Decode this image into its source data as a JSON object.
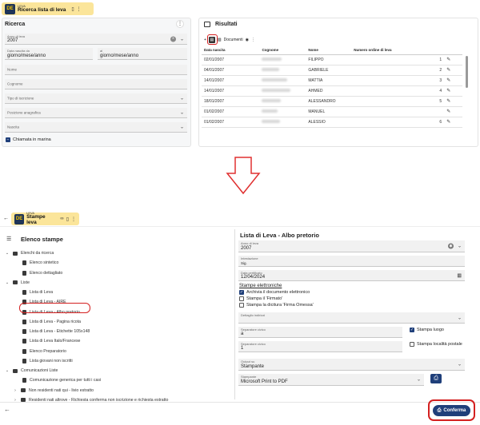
{
  "top": {
    "app_tab": {
      "logo": "DE",
      "subtitle": "LEVA",
      "title": "Ricerca lista di leva",
      "pin_icon": "pin-icon",
      "close_icon": "close-icon",
      "menu_icon": "more-vert-icon"
    },
    "search_panel": {
      "title": "Ricerca",
      "menu_icon": "more-vert-icon",
      "anno_label": "Anno di leva",
      "anno_value": "2007",
      "data_nascita_label": "Data nascita da",
      "data_nascita_value": "giorno/mese/anno",
      "al_label": "al",
      "al_value": "giorno/mese/anno",
      "nome_placeholder": "Nome",
      "cognome_placeholder": "Cognome",
      "tipo_iscrizione_placeholder": "Tipo di iscrizione",
      "posizione_placeholder": "Posizione anagrafica",
      "nascita_placeholder": "Nascita",
      "chiamata_label": "Chiamata in marina"
    },
    "results_panel": {
      "title": "Risultati",
      "docs_label": "Documenti",
      "columns": [
        "Data nascita",
        "Cognome",
        "Nome",
        "Numero ordine di leva"
      ],
      "rows": [
        {
          "date": "02/01/2007",
          "nome": "FILIPPO",
          "num": "1"
        },
        {
          "date": "04/01/2007",
          "nome": "GABRIELE",
          "num": "2"
        },
        {
          "date": "14/01/2007",
          "nome": "MATTIA",
          "num": "3"
        },
        {
          "date": "14/01/2007",
          "nome": "AHMED",
          "num": "4"
        },
        {
          "date": "18/01/2007",
          "nome": "ALESSANDRO",
          "num": "5"
        },
        {
          "date": "01/02/2007",
          "nome": "MANUEL",
          "num": ""
        },
        {
          "date": "01/02/2007",
          "nome": "ALESSIO",
          "num": "6"
        }
      ]
    }
  },
  "bottom": {
    "app_tab": {
      "logo": "DE",
      "subtitle": "LEVA",
      "title": "Stampe leva"
    },
    "left_panel": {
      "title": "Elenco stampe",
      "tree": [
        {
          "level": 0,
          "type": "folder",
          "label": "Elenchi da ricerca",
          "caret": "v"
        },
        {
          "level": 1,
          "type": "doc",
          "label": "Elenco sintetico"
        },
        {
          "level": 1,
          "type": "doc",
          "label": "Elenco dettagliato"
        },
        {
          "level": 0,
          "type": "folder",
          "label": "Liste",
          "caret": "v"
        },
        {
          "level": 1,
          "type": "doc",
          "label": "Lista di Leva"
        },
        {
          "level": 1,
          "type": "doc",
          "label": "Lista di Leva - AIRE"
        },
        {
          "level": 1,
          "type": "doc",
          "label": "Lista di Leva - Albo pretorio"
        },
        {
          "level": 1,
          "type": "doc",
          "label": "Lista di Leva - Pagina ricota"
        },
        {
          "level": 1,
          "type": "doc",
          "label": "Lista di Leva - Etichette 105x148"
        },
        {
          "level": 1,
          "type": "doc",
          "label": "Lista di Leva Italo/Francese"
        },
        {
          "level": 1,
          "type": "doc",
          "label": "Elenco Preparatorio"
        },
        {
          "level": 1,
          "type": "doc",
          "label": "Lista giovani non iscritti"
        },
        {
          "level": 0,
          "type": "folder",
          "label": "Comunicazioni Liste",
          "caret": "v"
        },
        {
          "level": 1,
          "type": "doc",
          "label": "Comunicazione generica per tutti i casi"
        },
        {
          "level": 1,
          "type": "folder",
          "label": "Non residenti nati qui - livio estratto",
          "caret": ">"
        },
        {
          "level": 1,
          "type": "folder",
          "label": "Residenti nati altrove - Richiesta conferma non iscrizione e richiesta estratto",
          "caret": ">"
        }
      ]
    },
    "right_panel": {
      "title": "Lista di Leva - Albo pretorio",
      "anno_label": "Anno di leva",
      "anno_value": "2007",
      "intestazione_label": "Intestazione",
      "intestazione_value": "Sig.",
      "data_cert_label": "Data certificato",
      "data_cert_value": "12/04/2024",
      "stampe_label": "Stampe elettroniche",
      "check1": "Archivia il documento elettronico",
      "check2": "Stampa il 'Firmato'",
      "check3": "Stampa la dicitura 'Firma Omessa'",
      "dettaglio_placeholder": "Dettaglio indirizzi",
      "copie_label": "Separatore civico",
      "copie_value": "a",
      "sep_label": "Separatore civico",
      "sep_value": "1",
      "stampa_luogo": "Stampa luogo",
      "stampa_localita": "Stampa località postale",
      "output_label": "Output su",
      "output_value": "Stampante",
      "stampante_label": "Stampante",
      "stampante_value": "Microsoft Print to PDF",
      "confirm_label": "Conferma"
    }
  }
}
